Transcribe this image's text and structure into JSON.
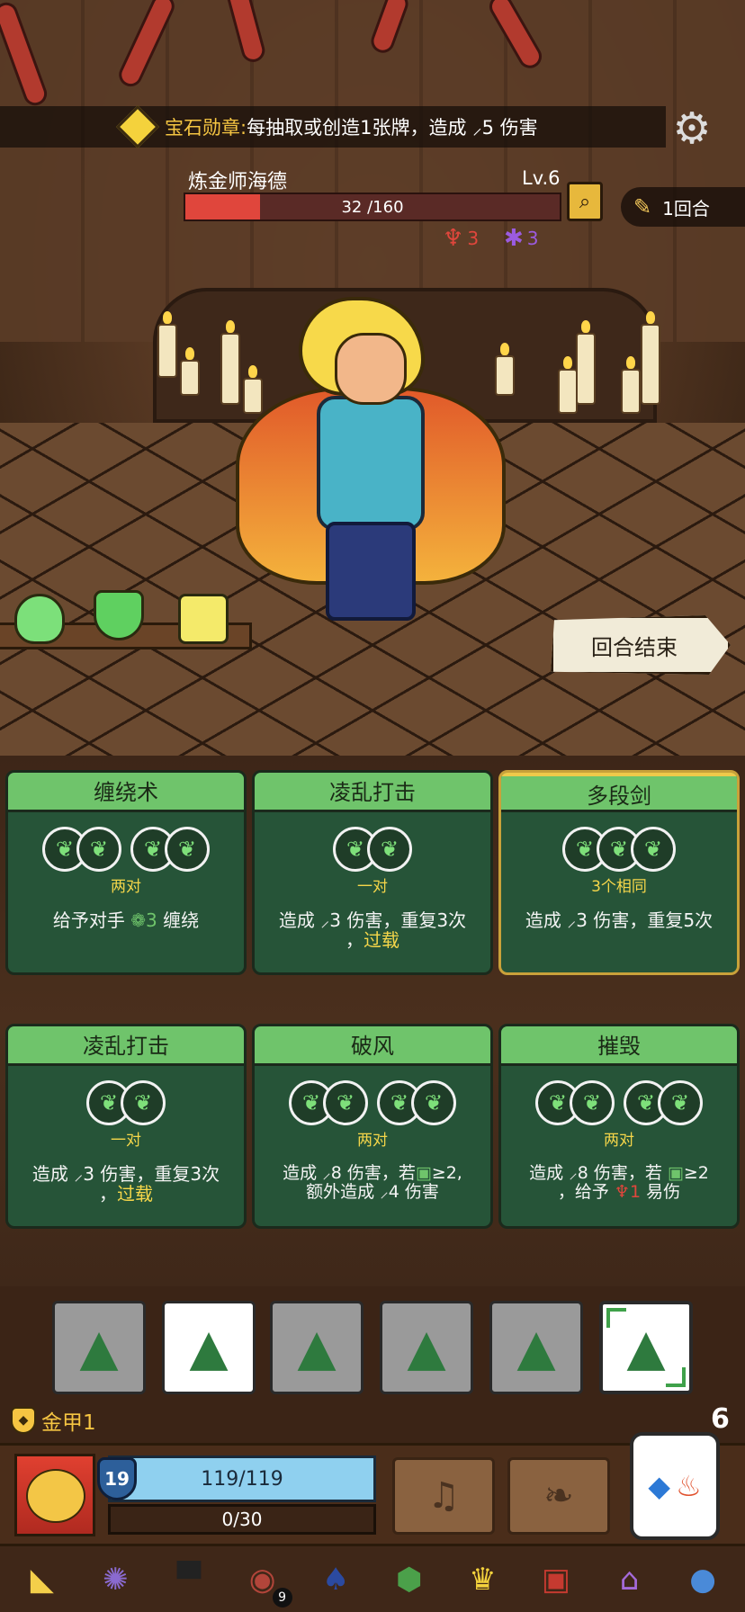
{
  "banner": {
    "label": "宝石勋章:",
    "description": "每抽取或创造1张牌，造成 ",
    "damage_value": "5",
    "damage_suffix": " 伤害"
  },
  "boss": {
    "name": "炼金师海德",
    "level": "Lv.6",
    "hp_text": "32 /160",
    "hp_fraction": 0.2,
    "status_rage": "3",
    "status_poison": "3"
  },
  "turn": {
    "label": "1回合"
  },
  "end_turn_label": "回合结束",
  "cards": [
    {
      "title": "缠绕术",
      "requirement": "两对",
      "effect_pre": "给予对手 ",
      "effect_value": "3",
      "effect_post": " 缠绕",
      "effect_kw": ""
    },
    {
      "title": "凌乱打击",
      "requirement": "一对",
      "effect_pre": "造成 ",
      "effect_value": "3",
      "effect_post": " 伤害，重复3次",
      "effect_kw": "过载",
      "effect_kw_prefix": "，"
    },
    {
      "title": "多段剑",
      "requirement": "3个相同",
      "effect_pre": "造成 ",
      "effect_value": "3",
      "effect_post": " 伤害，重复5次",
      "effect_kw": ""
    },
    {
      "title": "凌乱打击",
      "requirement": "一对",
      "effect_pre": "造成 ",
      "effect_value": "3",
      "effect_post": " 伤害，重复3次",
      "effect_kw": "过载",
      "effect_kw_prefix": "，"
    },
    {
      "title": "破风",
      "requirement": "两对",
      "effect_line1_pre": "造成 ",
      "effect_line1_value": "8",
      "effect_line1_post": " 伤害，若",
      "effect_line1_cond": "≥2,",
      "effect_line2_pre": "额外造成 ",
      "effect_line2_value": "4",
      "effect_line2_post": " 伤害"
    },
    {
      "title": "摧毁",
      "requirement": "两对",
      "effect_line1_pre": "造成 ",
      "effect_line1_value": "8",
      "effect_line1_post": " 伤害，若 ",
      "effect_line1_cond": "≥2",
      "effect_line2_pre": "，给予 ",
      "effect_line2_value": "1",
      "effect_line2_post": " 易伤"
    }
  ],
  "player": {
    "armor_label": "金甲1",
    "level": "19",
    "hp_text": "119/119",
    "energy_text": "0/30",
    "deck_count": "6"
  },
  "dice_icon": "tree-icon",
  "toolbar_badge": "9",
  "colors": {
    "card_green": "#6fc46b",
    "card_body": "#265438",
    "keyword_yellow": "#f5d64a",
    "hp_red": "#e0463c"
  }
}
